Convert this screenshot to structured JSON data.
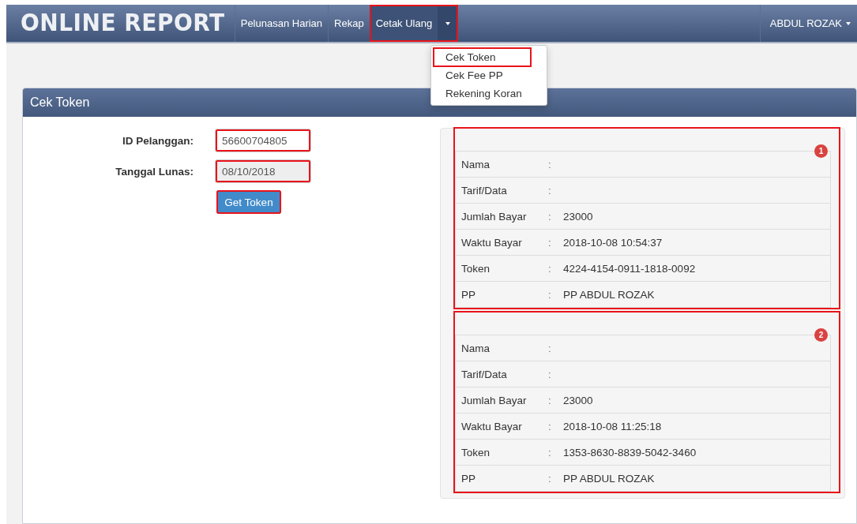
{
  "navbar": {
    "brand": "ONLINE REPORT",
    "items": [
      {
        "label": "Pelunasan Harian",
        "selected": false,
        "highlighted": false,
        "dropdown": false
      },
      {
        "label": "Rekap",
        "selected": false,
        "highlighted": false,
        "dropdown": false
      },
      {
        "label": "Cetak Ulang",
        "selected": true,
        "highlighted": true,
        "dropdown": true
      }
    ],
    "user": "ABDUL ROZAK"
  },
  "dropdown_menu": [
    {
      "label": "Cek Token",
      "highlighted": true
    },
    {
      "label": "Cek Fee PP",
      "highlighted": false
    },
    {
      "label": "Rekening Koran",
      "highlighted": false
    }
  ],
  "panel": {
    "title": "Cek Token",
    "form": [
      {
        "label": "ID Pelanggan:",
        "value": "56600704805",
        "disabled": false,
        "highlighted": true
      },
      {
        "label": "Tanggal Lunas:",
        "value": "08/10/2018",
        "disabled": true,
        "highlighted": true
      }
    ],
    "button": {
      "label": "Get Token",
      "highlighted": true
    },
    "results": [
      {
        "badge": "1",
        "highlighted": true,
        "rows": [
          {
            "label": "Nama",
            "separator": ":",
            "value": ""
          },
          {
            "label": "Tarif/Data",
            "separator": ":",
            "value": ""
          },
          {
            "label": "Jumlah Bayar",
            "separator": ":",
            "value": "23000"
          },
          {
            "label": "Waktu Bayar",
            "separator": ":",
            "value": "2018-10-08 10:54:37"
          },
          {
            "label": "Token",
            "separator": ":",
            "value": "4224-4154-0911-1818-0092"
          },
          {
            "label": "PP",
            "separator": ":",
            "value": "PP ABDUL ROZAK"
          }
        ]
      },
      {
        "badge": "2",
        "highlighted": true,
        "rows": [
          {
            "label": "Nama",
            "separator": ":",
            "value": ""
          },
          {
            "label": "Tarif/Data",
            "separator": ":",
            "value": ""
          },
          {
            "label": "Jumlah Bayar",
            "separator": ":",
            "value": "23000"
          },
          {
            "label": "Waktu Bayar",
            "separator": ":",
            "value": "2018-10-08 11:25:18"
          },
          {
            "label": "Token",
            "separator": ":",
            "value": "1353-8630-8839-5042-3460"
          },
          {
            "label": "PP",
            "separator": ":",
            "value": "PP ABDUL ROZAK"
          }
        ]
      }
    ]
  }
}
